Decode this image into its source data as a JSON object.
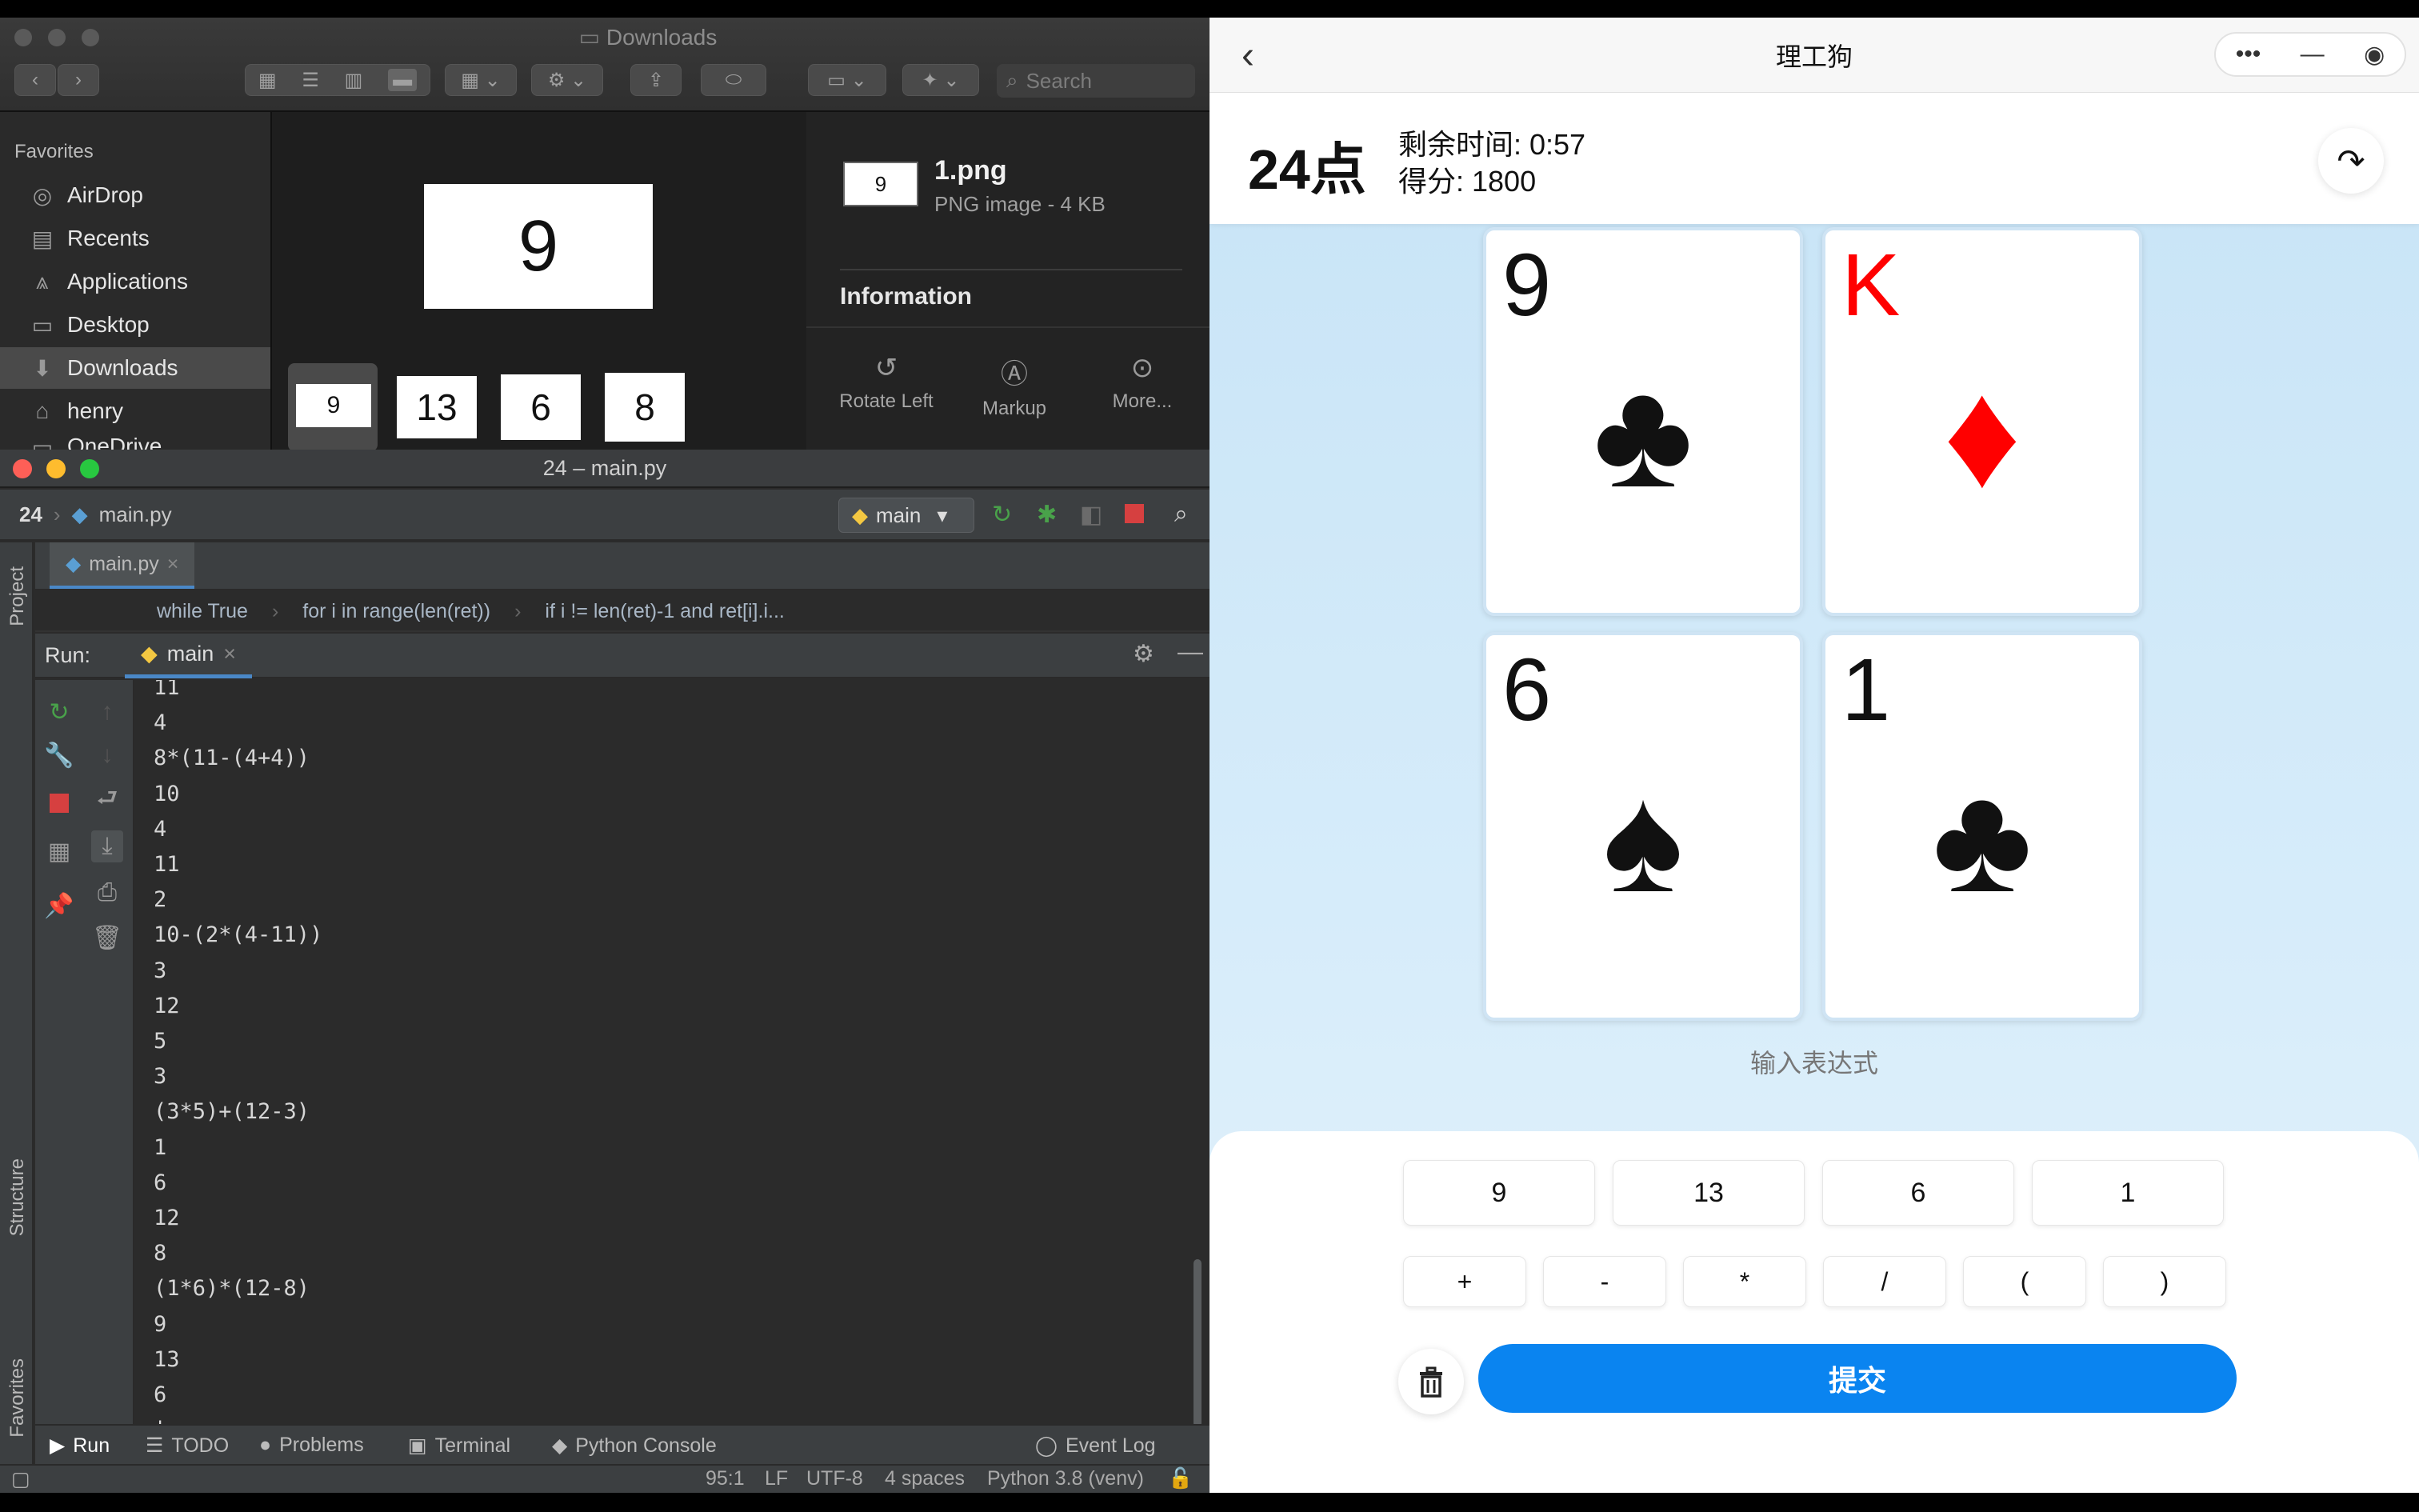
{
  "finder": {
    "title": "Downloads",
    "search_placeholder": "Search",
    "sidebar_heading": "Favorites",
    "sidebar_items": [
      {
        "label": "AirDrop",
        "icon": "airdrop-icon"
      },
      {
        "label": "Recents",
        "icon": "clock-icon"
      },
      {
        "label": "Applications",
        "icon": "applications-icon"
      },
      {
        "label": "Desktop",
        "icon": "desktop-icon"
      },
      {
        "label": "Downloads",
        "icon": "download-icon"
      },
      {
        "label": "henry",
        "icon": "home-icon"
      },
      {
        "label": "OneDrive",
        "icon": "folder-icon"
      }
    ],
    "preview_value": "9",
    "thumbnails": [
      "9",
      "13",
      "6",
      "8"
    ],
    "info": {
      "thumb": "9",
      "filename": "1.png",
      "filetype": "PNG image - 4 KB",
      "heading": "Information",
      "actions": [
        "Rotate Left",
        "Markup",
        "More..."
      ]
    }
  },
  "pycharm": {
    "window_title": "24 – main.py",
    "project": "24",
    "file": "main.py",
    "run_config": "main",
    "tab": "main.py",
    "code_breadcrumb": [
      "while True",
      "for i in range(len(ret))",
      "if i != len(ret)-1 and ret[i].i..."
    ],
    "run_label": "Run:",
    "run_tab": "main",
    "side_labels": [
      "Project",
      "Structure",
      "Favorites"
    ],
    "console_lines": [
      "11",
      "4",
      "8*(11-(4+4))",
      "10",
      "4",
      "11",
      "2",
      "10-(2*(4-11))",
      "3",
      "12",
      "5",
      "3",
      "(3*5)+(12-3)",
      "1",
      "6",
      "12",
      "8",
      "(1*6)*(12-8)",
      "9",
      "13",
      "6",
      ""
    ],
    "bottom_tabs": [
      "Run",
      "TODO",
      "Problems",
      "Terminal",
      "Python Console",
      "Event Log"
    ],
    "status": {
      "position": "95:1",
      "line_sep": "LF",
      "encoding": "UTF-8",
      "indent": "4 spaces",
      "interpreter": "Python 3.8 (venv)"
    }
  },
  "mini": {
    "nav_title": "理工狗",
    "game_title": "24点",
    "timer": "剩余时间: 0:57",
    "score": "得分: 1800",
    "cards": [
      {
        "rank": "9",
        "suit": "♣",
        "color": "#111111"
      },
      {
        "rank": "K",
        "suit": "♦",
        "color": "#ff0000"
      },
      {
        "rank": "6",
        "suit": "♠",
        "color": "#111111"
      },
      {
        "rank": "1",
        "suit": "♣",
        "color": "#111111"
      }
    ],
    "expression_placeholder": "输入表达式",
    "number_keys": [
      "9",
      "13",
      "6",
      "1"
    ],
    "operator_keys": [
      "+",
      "-",
      "*",
      "/",
      "(",
      ")"
    ],
    "submit_label": "提交",
    "accent": "#0a84f0"
  }
}
